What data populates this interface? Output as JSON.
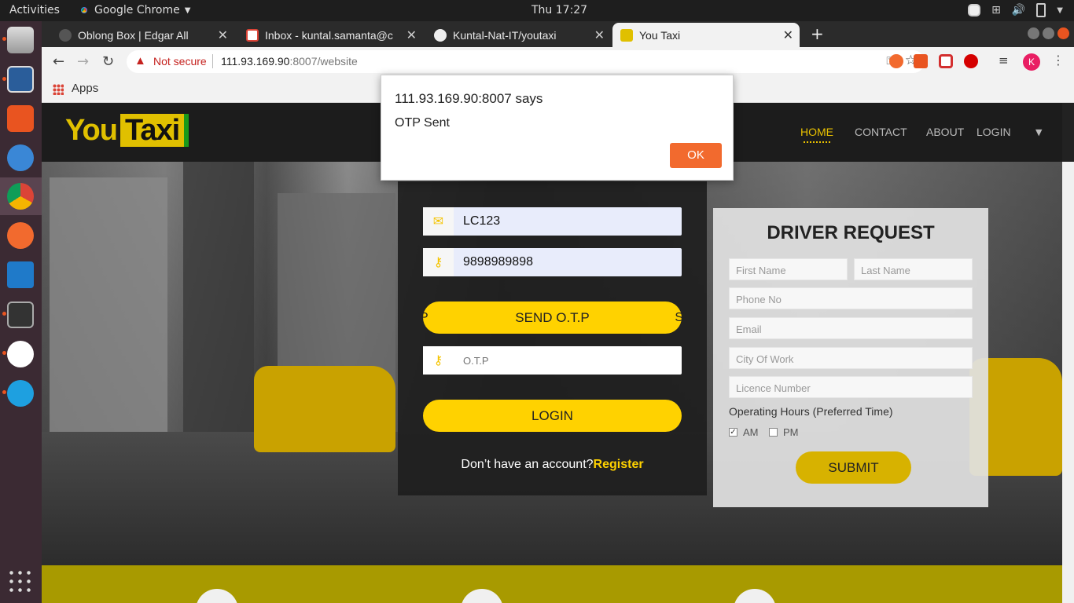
{
  "topbar": {
    "activities": "Activities",
    "app_name": "Google Chrome",
    "clock": "Thu 17:27"
  },
  "tabs": [
    {
      "title": "Oblong Box | Edgar All",
      "icon": "oblong-box-favicon"
    },
    {
      "title": "Inbox - kuntal.samanta@c",
      "icon": "gmail-icon"
    },
    {
      "title": "Kuntal-Nat-IT/youtaxi",
      "icon": "github-icon"
    },
    {
      "title": "You Taxi",
      "icon": "youtaxi-favicon",
      "active": true
    }
  ],
  "toolbar": {
    "not_secure": "Not secure",
    "url_host": "111.93.169.90",
    "url_rest": ":8007/website",
    "avatar_letter": "K"
  },
  "bookmarks": {
    "apps_label": "Apps"
  },
  "site": {
    "logo_you": "You",
    "logo_taxi": "Taxi",
    "nav": [
      "HOME",
      "CONTACT",
      "ABOUT",
      "LOGIN"
    ],
    "colors": {
      "accent": "#ffd200",
      "nav_active": "#e8c000"
    }
  },
  "login": {
    "username_value": "LC123",
    "phone_value": "9898989898",
    "send_otp_label": "SEND O.T.P",
    "otp_placeholder": "O.T.P",
    "login_label": "LOGIN",
    "no_account": "Don’t have an account?",
    "register_link": "Register"
  },
  "driver": {
    "title": "DRIVER REQUEST",
    "first_name_ph": "First Name",
    "last_name_ph": "Last Name",
    "phone_ph": "Phone No",
    "email_ph": "Email",
    "city_ph": "City Of Work",
    "licence_ph": "Licence Number",
    "hours_label": "Operating Hours (Preferred Time)",
    "am_label": "AM",
    "pm_label": "PM",
    "am_checked": true,
    "pm_checked": false,
    "submit_label": "SUBMIT"
  },
  "alert": {
    "title": "111.93.169.90:8007 says",
    "message": "OTP Sent",
    "ok_label": "OK"
  }
}
